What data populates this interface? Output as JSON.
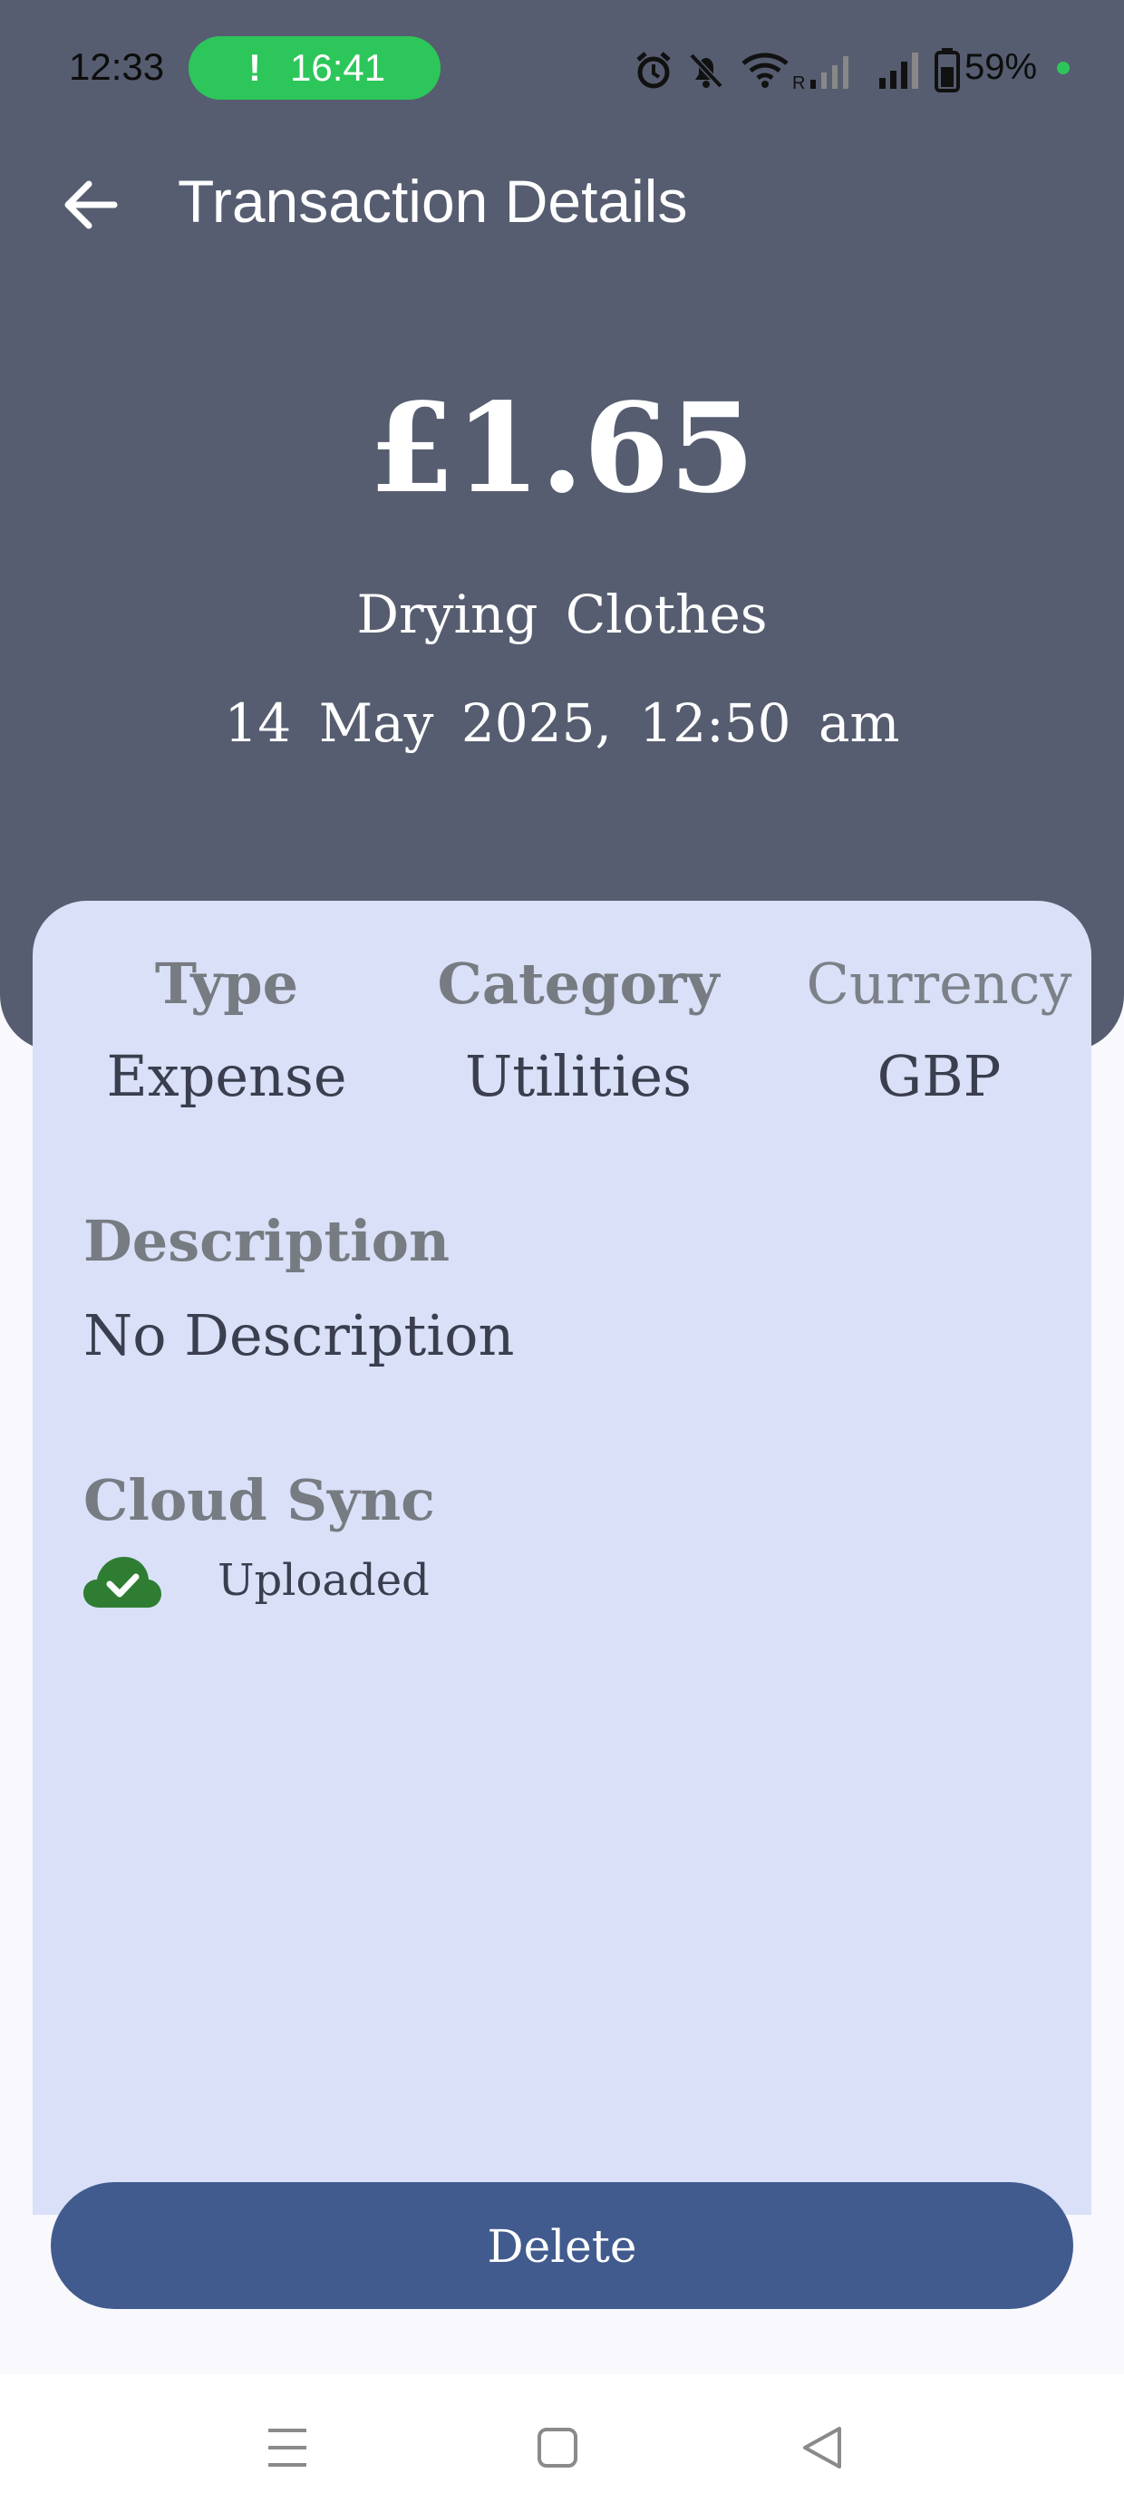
{
  "status_bar": {
    "time": "12:33",
    "timer": {
      "alert_glyph": "!",
      "value": "16:41"
    },
    "icons": [
      "alarm-icon",
      "bell-muted-icon",
      "wifi-icon",
      "signal-icon",
      "signal-icon",
      "battery-icon"
    ],
    "roaming_label": "R",
    "battery_percent": "59%"
  },
  "header": {
    "back_icon": "arrow-left-icon",
    "title": "Transaction Details",
    "amount": "£1.65",
    "name": "Drying Clothes",
    "datetime": "14 May 2025, 12:50 am"
  },
  "details": {
    "type_label": "Type",
    "type_value": "Expense",
    "category_label": "Category",
    "category_value": "Utilities",
    "currency_label": "Currency",
    "currency_value": "GBP",
    "description_label": "Description",
    "description_value": "No Description",
    "sync_label": "Cloud Sync",
    "sync_status": "Uploaded",
    "sync_icon": "cloud-check-icon"
  },
  "actions": {
    "delete_label": "Delete"
  },
  "nav": {
    "icons": [
      "menu-icon",
      "home-square-icon",
      "back-triangle-icon"
    ]
  },
  "colors": {
    "header_bg": "#565d70",
    "card_bg": "#d9e0f7",
    "button_bg": "#415b8e",
    "success_green": "#2e7d32",
    "timer_green": "#2dc65a"
  }
}
